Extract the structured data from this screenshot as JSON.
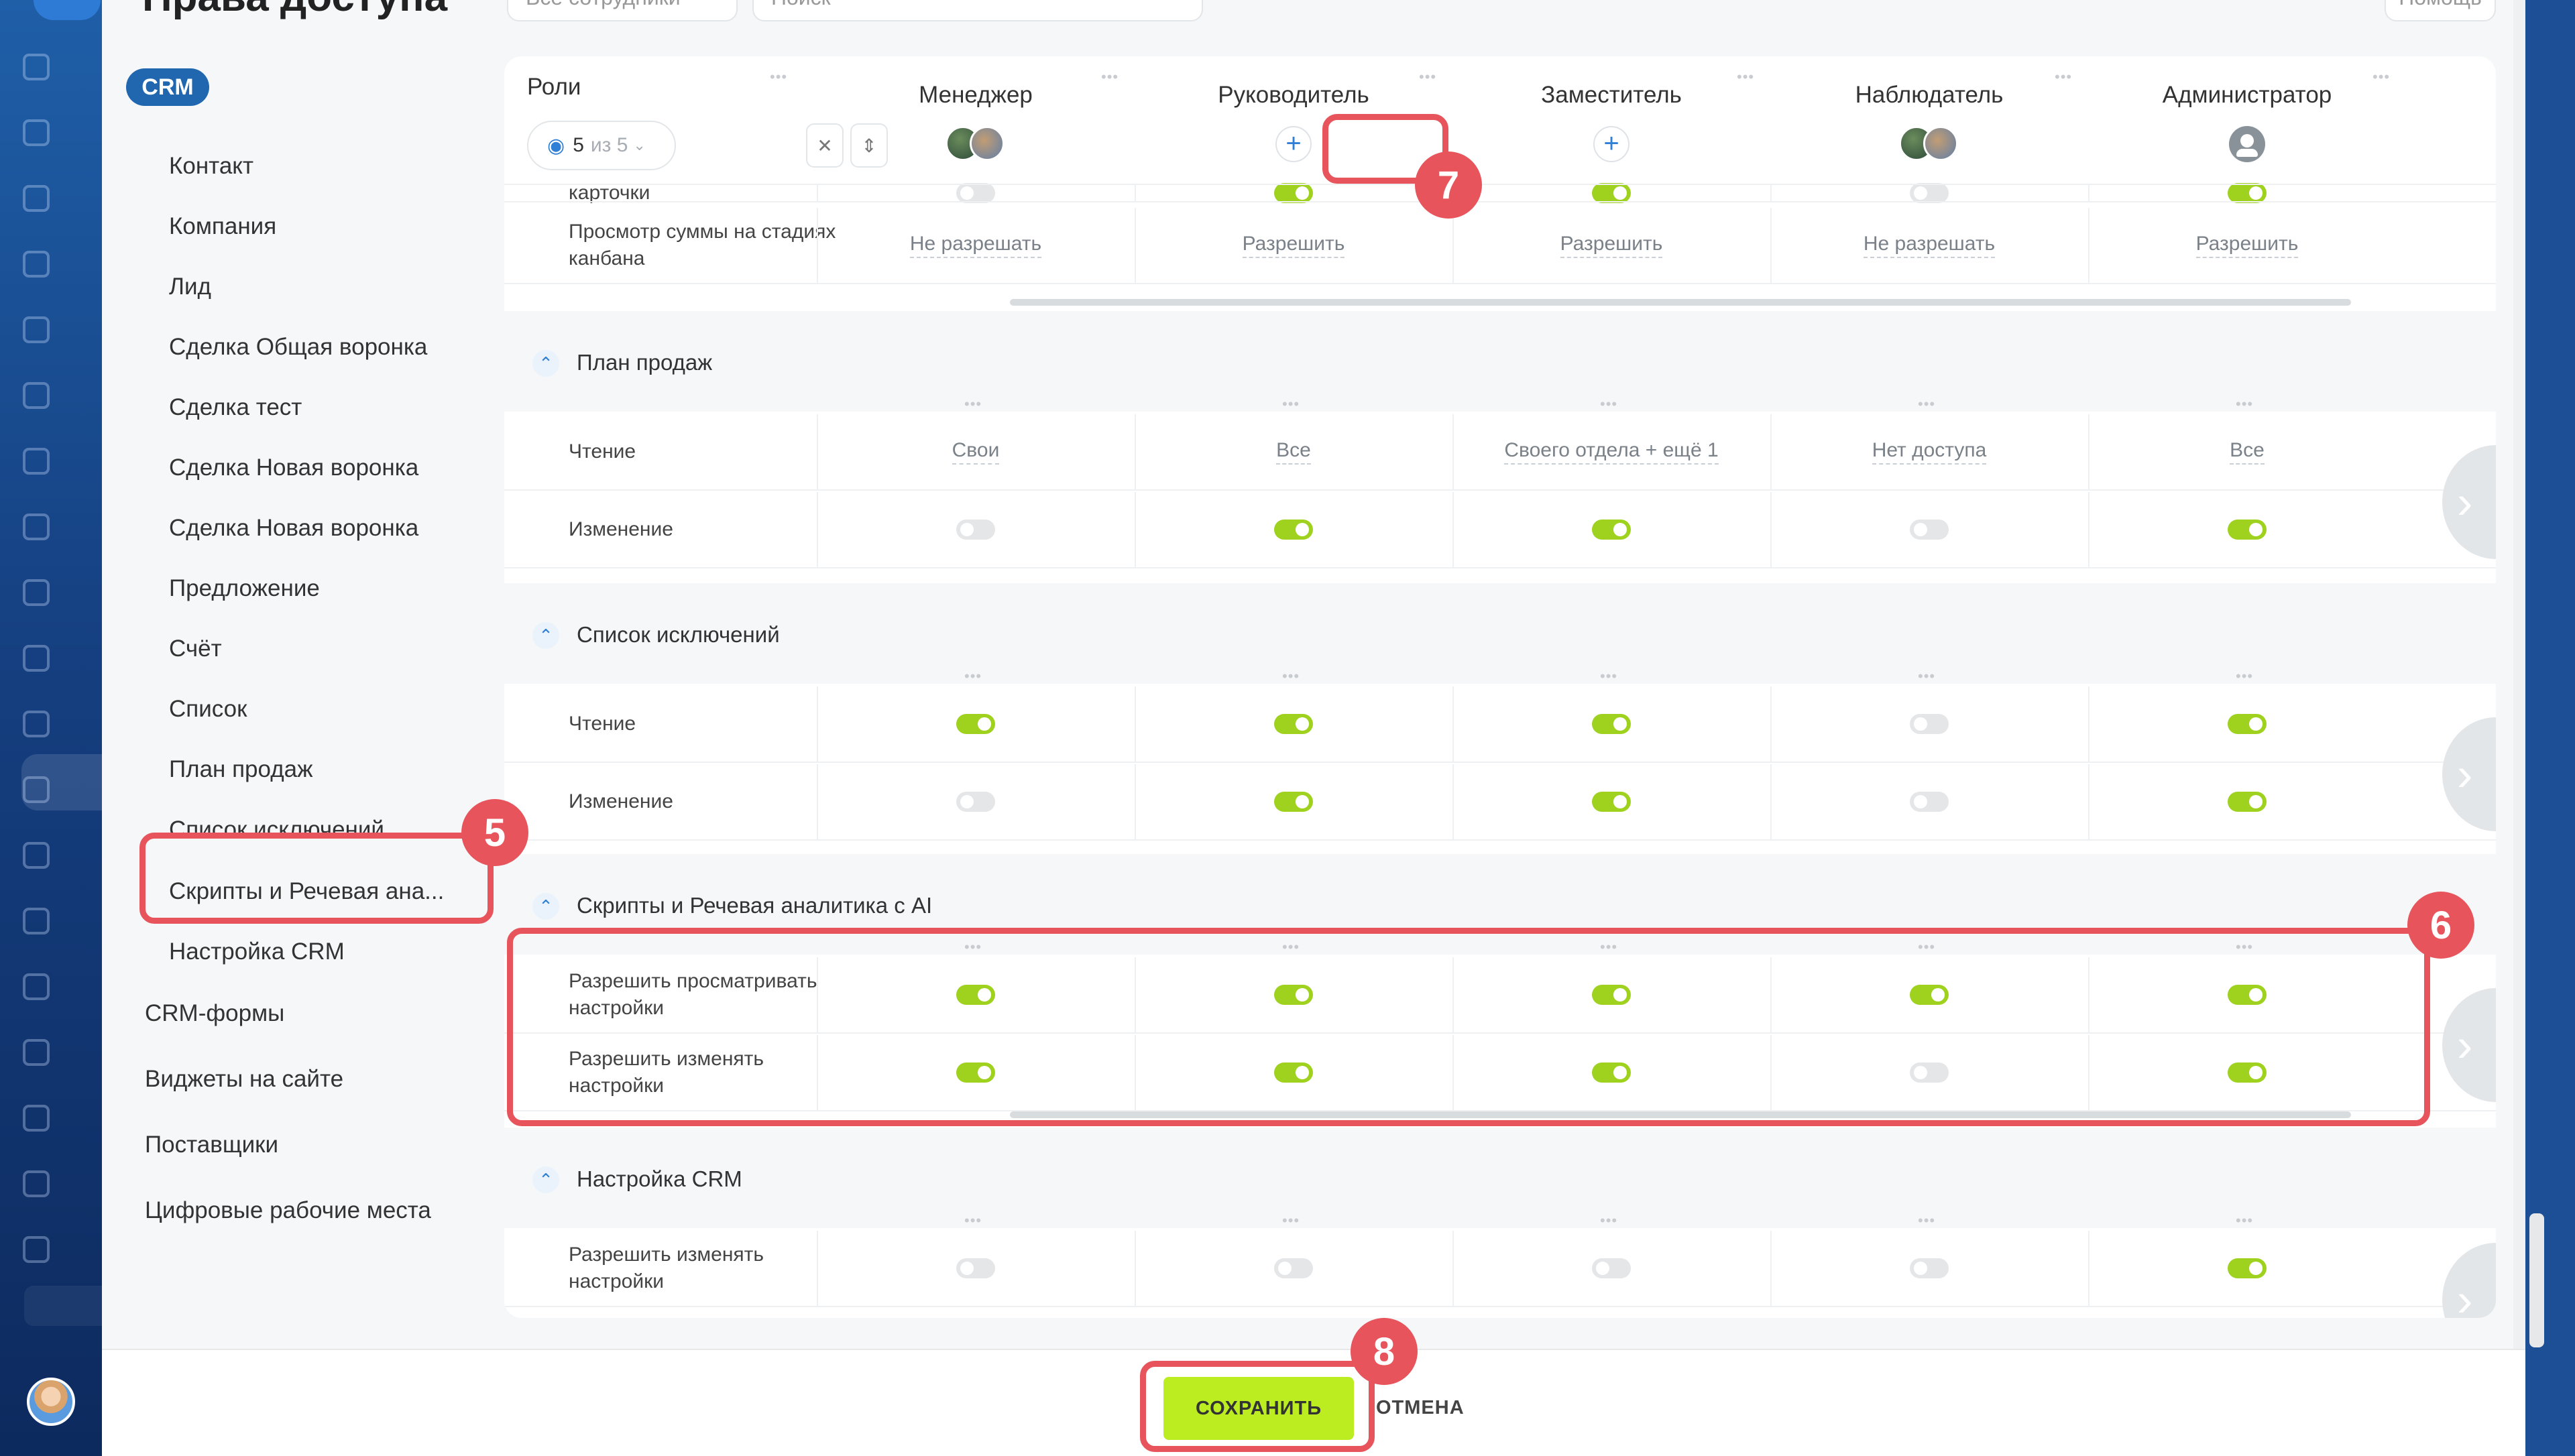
{
  "page_title": "Права доступа",
  "toolbar": {
    "employees_dropdown": "Все сотрудники",
    "search_placeholder": "Поиск",
    "help_label": "Помощь"
  },
  "sidebar": {
    "crm_badge": "CRM",
    "items": [
      {
        "label": "Контакт",
        "level": "sub"
      },
      {
        "label": "Компания",
        "level": "sub"
      },
      {
        "label": "Лид",
        "level": "sub"
      },
      {
        "label": "Сделка Общая воронка",
        "level": "sub"
      },
      {
        "label": "Сделка тест",
        "level": "sub"
      },
      {
        "label": "Сделка Новая воронка",
        "level": "sub"
      },
      {
        "label": "Сделка Новая воронка",
        "level": "sub"
      },
      {
        "label": "Предложение",
        "level": "sub"
      },
      {
        "label": "Счёт",
        "level": "sub"
      },
      {
        "label": "Список",
        "level": "sub"
      },
      {
        "label": "План продаж",
        "level": "sub"
      },
      {
        "label": "Список исключений",
        "level": "sub"
      },
      {
        "label": "Скрипты и Речевая ана...",
        "level": "sub",
        "highlighted": true
      },
      {
        "label": "Настройка CRM",
        "level": "sub"
      },
      {
        "label": "CRM-формы",
        "level": "top"
      },
      {
        "label": "Виджеты на сайте",
        "level": "top"
      },
      {
        "label": "Поставщики",
        "level": "top"
      },
      {
        "label": "Цифровые рабочие места",
        "level": "top"
      }
    ]
  },
  "header": {
    "roles_label": "Роли",
    "filter_count": "5",
    "filter_of": "из 5",
    "collapse_icon": "collapse-icon",
    "expand_icon": "expand-icon",
    "roles": [
      {
        "name": "Менеджер",
        "members": "avatars"
      },
      {
        "name": "Руководитель",
        "members": "add"
      },
      {
        "name": "Заместитель",
        "members": "add"
      },
      {
        "name": "Наблюдатель",
        "members": "avatars"
      },
      {
        "name": "Администратор",
        "members": "group"
      }
    ]
  },
  "rows_top": [
    {
      "label": "карточки",
      "type": "toggle",
      "values": [
        false,
        true,
        true,
        false,
        true
      ]
    },
    {
      "label": "Просмотр суммы на стадиях канбана",
      "type": "text",
      "values": [
        "Не разрешать",
        "Разрешить",
        "Разрешить",
        "Не разрешать",
        "Разрешить"
      ]
    }
  ],
  "sections": [
    {
      "title": "План продаж",
      "rows": [
        {
          "label": "Чтение",
          "type": "text",
          "values": [
            "Свои",
            "Все",
            "Своего отдела + ещё 1",
            "Нет доступа",
            "Все"
          ]
        },
        {
          "label": "Изменение",
          "type": "toggle",
          "values": [
            false,
            true,
            true,
            false,
            true
          ]
        }
      ]
    },
    {
      "title": "Список исключений",
      "rows": [
        {
          "label": "Чтение",
          "type": "toggle",
          "values": [
            true,
            true,
            true,
            false,
            true
          ]
        },
        {
          "label": "Изменение",
          "type": "toggle",
          "values": [
            false,
            true,
            true,
            false,
            true
          ]
        }
      ]
    },
    {
      "title": "Скрипты и Речевая аналитика с AI",
      "rows": [
        {
          "label": "Разрешить просматривать настройки",
          "type": "toggle",
          "values": [
            true,
            true,
            true,
            true,
            true
          ]
        },
        {
          "label": "Разрешить изменять настройки",
          "type": "toggle",
          "values": [
            true,
            true,
            true,
            false,
            true
          ]
        }
      ]
    },
    {
      "title": "Настройка CRM",
      "rows": [
        {
          "label": "Разрешить изменять настройки",
          "type": "toggle",
          "values": [
            false,
            false,
            false,
            false,
            true
          ]
        }
      ]
    }
  ],
  "footer": {
    "save_label": "СОХРАНИТЬ",
    "cancel_label": "ОТМЕНА"
  },
  "callouts": [
    "5",
    "6",
    "7",
    "8"
  ],
  "colors": {
    "accent": "#2067b0",
    "toggle_on": "#9fd21f",
    "toggle_off": "#e4e6e8",
    "save_button": "#bbed21",
    "callout": "#e8545c"
  }
}
